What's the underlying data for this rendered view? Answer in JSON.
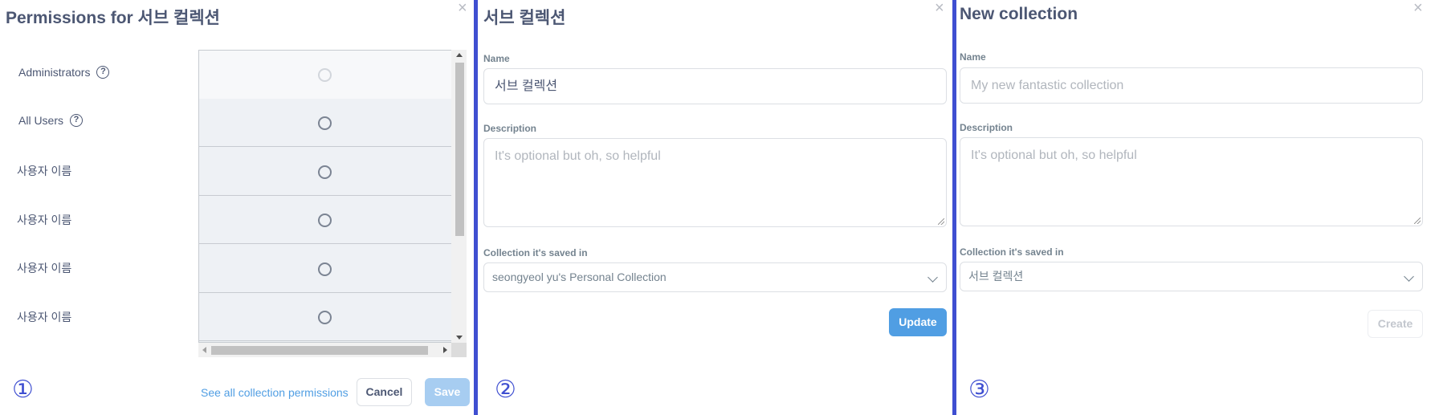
{
  "permissions_panel": {
    "title": "Permissions for  서브 컬렉션",
    "close_icon": "×",
    "rows": [
      {
        "label": "Administrators",
        "has_help": true
      },
      {
        "label": "All Users",
        "has_help": true
      },
      {
        "label": "사용자 이름",
        "has_help": false
      },
      {
        "label": "사용자 이름",
        "has_help": false
      },
      {
        "label": "사용자 이름",
        "has_help": false
      },
      {
        "label": "사용자 이름",
        "has_help": false
      }
    ],
    "help_icon": "?",
    "see_all_link": "See all collection permissions",
    "cancel_label": "Cancel",
    "save_label": "Save",
    "step_number": "①"
  },
  "edit_panel": {
    "title": "서브 컬렉션",
    "close_icon": "×",
    "name_label": "Name",
    "name_value": "서브 컬렉션",
    "description_label": "Description",
    "description_placeholder": "It's optional but oh, so helpful",
    "saved_in_label": "Collection it's saved in",
    "saved_in_value": "seongyeol yu's Personal Collection",
    "update_label": "Update",
    "step_number": "②"
  },
  "new_panel": {
    "title": "New collection",
    "close_icon": "×",
    "name_label": "Name",
    "name_placeholder": "My new fantastic collection",
    "description_label": "Description",
    "description_placeholder": "It's optional but oh, so helpful",
    "saved_in_label": "Collection it's saved in",
    "saved_in_value": "서브 컬렉션",
    "create_label": "Create",
    "step_number": "③"
  },
  "colors": {
    "divider": "#3f4fd1",
    "primary": "#509ee3",
    "primary_disabled": "#a7cdf1",
    "text": "#4c5773"
  }
}
